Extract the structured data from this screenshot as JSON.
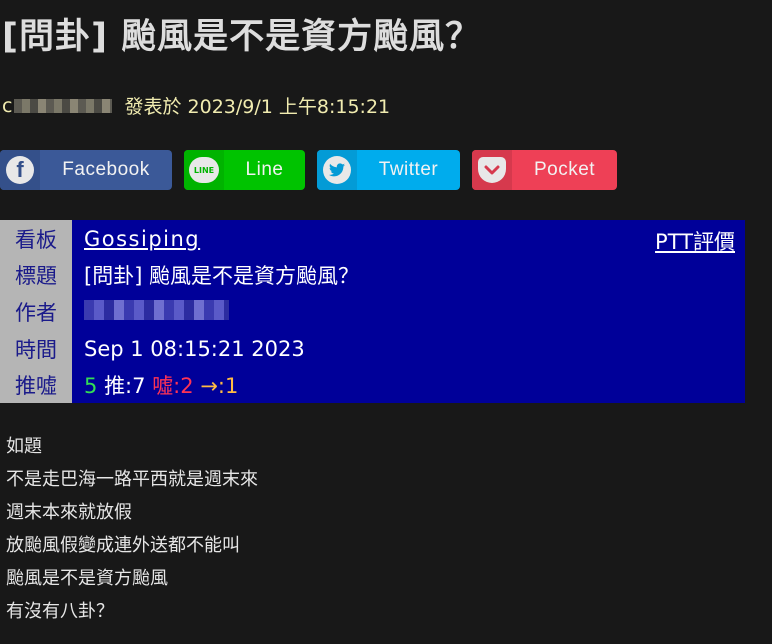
{
  "article": {
    "title": "[問卦] 颱風是不是資方颱風？",
    "author_prefix": "c",
    "posted_label": "發表於",
    "posted_datetime": "2023/9/1 上午8:15:21"
  },
  "share": {
    "facebook": {
      "label": "Facebook",
      "icon": "facebook-icon",
      "color": "#3b5998"
    },
    "line": {
      "label": "Line",
      "icon": "line-icon",
      "icon_text": "LINE",
      "color": "#00c300"
    },
    "twitter": {
      "label": "Twitter",
      "icon": "twitter-icon",
      "color": "#00aced"
    },
    "pocket": {
      "label": "Pocket",
      "icon": "pocket-icon",
      "color": "#ee4056"
    }
  },
  "info": {
    "board_key": "看板",
    "board_value": "Gossiping",
    "ptt_rating": "PTT評價",
    "title_key": "標題",
    "title_value": "[問卦] 颱風是不是資方颱風？",
    "author_key": "作者",
    "time_key": "時間",
    "time_value": "Sep 1 08:15:21 2023",
    "push_key": "推噓",
    "push_total": "5",
    "push_up": "推:7",
    "push_down": "噓:2",
    "push_arrow": "→:1"
  },
  "body": {
    "lines": [
      "如題",
      "不是走巴海一路平西就是週末來",
      "週末本來就放假",
      "放颱風假變成連外送都不能叫",
      "颱風是不是資方颱風",
      "有沒有八卦？"
    ]
  }
}
